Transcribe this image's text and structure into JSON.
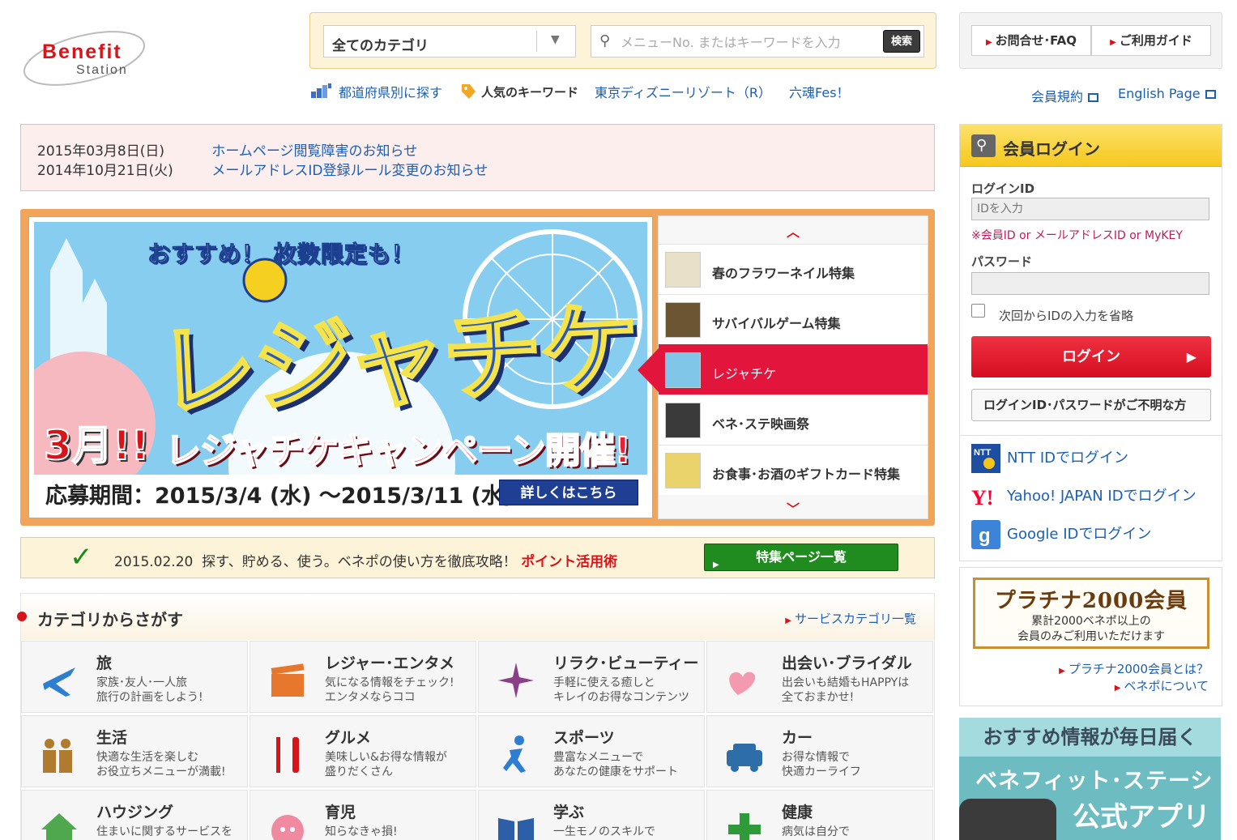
{
  "logo": {
    "word": "Benefit",
    "sub": "Station"
  },
  "search": {
    "category": "全てのカテゴリ",
    "placeholder": "メニューNo. またはキーワードを入力",
    "button": "検索"
  },
  "subnav": {
    "prefecture": "都道府県別に探す",
    "popular": "人気のキーワード",
    "keywords": [
      "東京ディズニーリゾート（R）",
      "六魂Fes！"
    ]
  },
  "toplinks": {
    "faq": "お問合せ･FAQ",
    "guide": "ご利用ガイド"
  },
  "rightlinks": {
    "terms": "会員規約",
    "english": "English Page"
  },
  "news": [
    {
      "date": "2015年03月8日(日)",
      "title": "ホームページ閲覧障害のお知らせ"
    },
    {
      "date": "2014年10月21日(火)",
      "title": "メールアドレスID登録ルール変更のお知らせ"
    }
  ],
  "banner": {
    "top": "おすすめ！ 枚数限定も！",
    "main": "レジャチケ",
    "march": "3月!!",
    "campaign": "レジャチケキャンペーン開催!",
    "period": "応募期間：2015/3/4 (水) ～2015/3/11 (水)",
    "detail": "詳しくはこちら"
  },
  "features": [
    {
      "label": "春のフラワーネイル特集",
      "color": "#e9e0c8",
      "active": false
    },
    {
      "label": "サバイバルゲーム特集",
      "color": "#6b5634",
      "active": false
    },
    {
      "label": "レジャチケ",
      "color": "#7fc6e8",
      "active": true
    },
    {
      "label": "ベネ･ステ映画祭",
      "color": "#3a3a3a",
      "active": false
    },
    {
      "label": "お食事･お酒のギフトカード特集",
      "color": "#e9d36a",
      "active": false
    }
  ],
  "point": {
    "date": "2015.02.20",
    "text": "探す、貯める、使う。ベネポの使い方を徹底攻略！",
    "highlight": "ポイント活用術",
    "button": "特集ページ一覧"
  },
  "categories": {
    "title": "カテゴリからさがす",
    "all": "サービスカテゴリ一覧",
    "items": [
      {
        "name": "旅",
        "d1": "家族･友人･一人旅",
        "d2": "旅行の計画をしよう!",
        "icon": "airplane-icon"
      },
      {
        "name": "レジャー･エンタメ",
        "d1": "気になる情報をチェック!",
        "d2": "エンタメならココ",
        "icon": "clapper-icon"
      },
      {
        "name": "リラク･ビューティー",
        "d1": "手軽に使える癒しと",
        "d2": "キレイのお得なコンテンツ",
        "icon": "sparkle-icon"
      },
      {
        "name": "出会い･ブライダル",
        "d1": "出会いも結婚もHAPPYは",
        "d2": "全ておまかせ!",
        "icon": "hearts-icon"
      },
      {
        "name": "生活",
        "d1": "快適な生活を楽しむ",
        "d2": "お役立ちメニューが満載!",
        "icon": "family-icon"
      },
      {
        "name": "グルメ",
        "d1": "美味しい&お得な情報が",
        "d2": "盛りだくさん",
        "icon": "fork-knife-icon"
      },
      {
        "name": "スポーツ",
        "d1": "豊富なメニューで",
        "d2": "あなたの健康をサポート",
        "icon": "runner-icon"
      },
      {
        "name": "カー",
        "d1": "お得な情報で",
        "d2": "快適カーライフ",
        "icon": "car-icon"
      },
      {
        "name": "ハウジング",
        "d1": "住まいに関するサービスを",
        "d2": "",
        "icon": "house-icon"
      },
      {
        "name": "育児",
        "d1": "知らなきゃ損!",
        "d2": "",
        "icon": "baby-icon"
      },
      {
        "name": "学ぶ",
        "d1": "一生モノのスキルで",
        "d2": "",
        "icon": "book-icon"
      },
      {
        "name": "健康",
        "d1": "病気は自分で",
        "d2": "",
        "icon": "cross-icon"
      }
    ]
  },
  "login": {
    "title": "会員ログイン",
    "id_label": "ログインID",
    "id_placeholder": "IDを入力",
    "id_note": "※会員ID or メールアドレスID or MyKEY",
    "pw_label": "パスワード",
    "remember": "次回からIDの入力を省略",
    "button": "ログイン",
    "forgot": "ログインID･パスワードがご不明な方",
    "ntt": "NTT IDでログイン",
    "yahoo": "Yahoo! JAPAN IDでログイン",
    "google": "Google IDでログイン"
  },
  "platinum": {
    "title": "プラチナ2000会員",
    "line1": "累計2000ベネポ以上の",
    "line2": "会員のみご利用いただけます",
    "link1": "プラチナ2000会員とは？",
    "link2": "ベネポについて"
  },
  "app": {
    "line1": "おすすめ情報が毎日届く",
    "line2": "ベネフィット･ステーション",
    "line3": "公式アプリ"
  }
}
